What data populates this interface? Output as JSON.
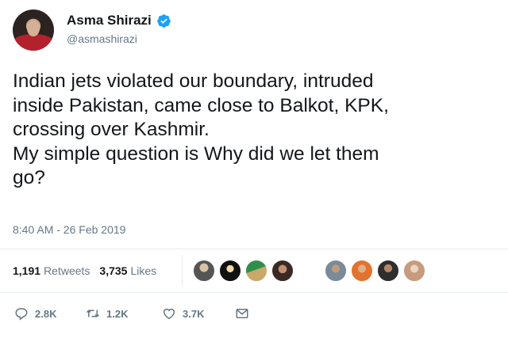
{
  "author": {
    "display_name": "Asma Shirazi",
    "handle": "@asmashirazi",
    "verified": true,
    "verified_color": "#1da1f2"
  },
  "tweet": {
    "text": "Indian jets violated our boundary, intruded\ninside Pakistan, came close to Balkot, KPK,\ncrossing over Kashmir.\nMy simple question is Why did we let them\ngo?",
    "timestamp": "8:40 AM - 26 Feb 2019"
  },
  "stats": {
    "retweets_count": "1,191",
    "retweets_label": "Retweets",
    "likes_count": "3,735",
    "likes_label": "Likes"
  },
  "actions": {
    "reply_count": "2.8K",
    "retweet_count": "1.2K",
    "like_count": "3.7K"
  },
  "colors": {
    "text": "#14171a",
    "secondary": "#657786",
    "divider": "#e6ecf0",
    "accent": "#1da1f2"
  },
  "icons": [
    "reply-icon",
    "retweet-icon",
    "like-icon",
    "direct-message-icon",
    "verified-badge-icon"
  ]
}
